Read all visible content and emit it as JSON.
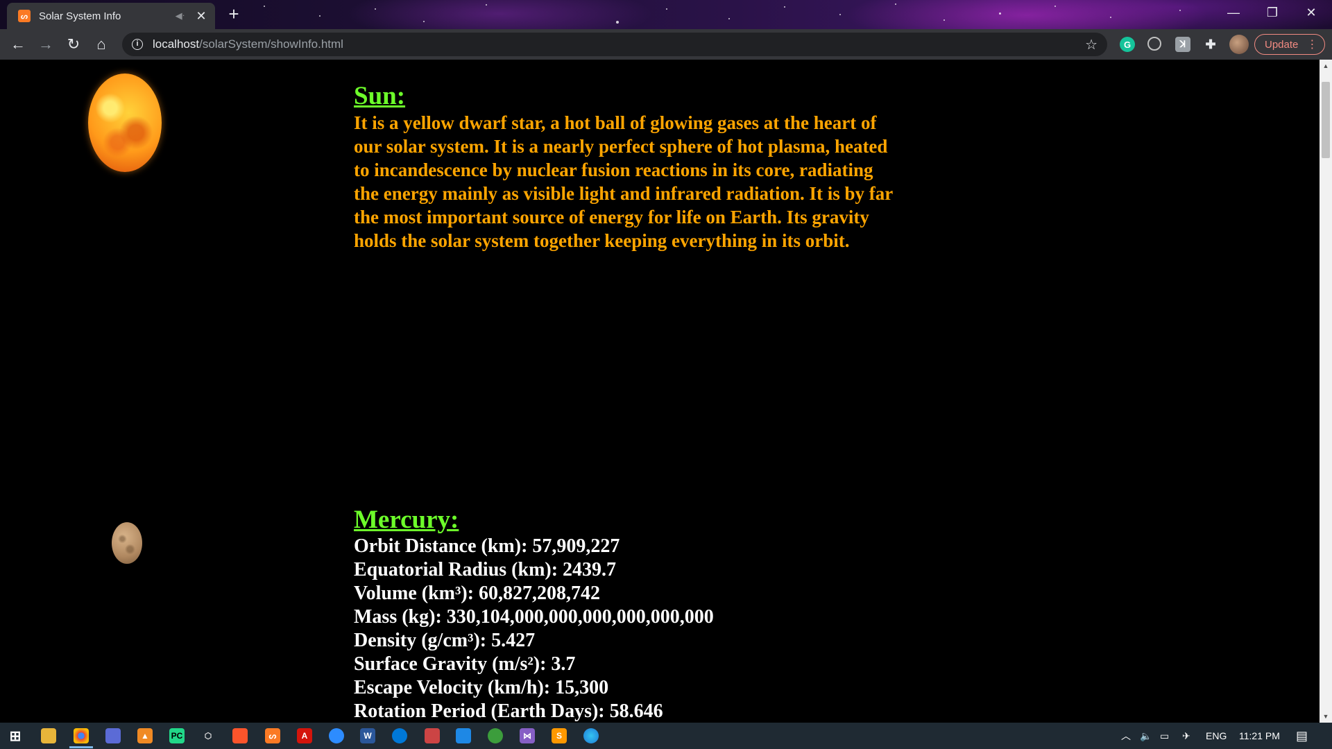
{
  "browser": {
    "tab_title": "Solar System Info",
    "url_host": "localhost",
    "url_path": "/solarSystem/showInfo.html",
    "update_label": "Update"
  },
  "page": {
    "sun": {
      "title": "Sun:",
      "description": "It is a yellow dwarf star, a hot ball of glowing gases at the heart of our solar system. It is a nearly perfect sphere of hot plasma, heated to incandescence by nuclear fusion reactions in its core, radiating the energy mainly as visible light and infrared radiation. It is by far the most important source of energy for life on Earth. Its gravity holds the solar system together keeping everything in its orbit."
    },
    "mercury": {
      "title": "Mercury:",
      "stats": [
        "Orbit Distance (km): 57,909,227",
        "Equatorial Radius (km): 2439.7",
        "Volume (km³): 60,827,208,742",
        "Mass (kg): 330,104,000,000,000,000,000,000",
        "Density (g/cm³): 5.427",
        "Surface Gravity (m/s²): 3.7",
        "Escape Velocity (km/h): 15,300",
        "Rotation Period (Earth Days): 58.646"
      ]
    }
  },
  "colors": {
    "heading": "#6dff2a",
    "sun_text": "#ffa500",
    "stat_text": "#ffffff",
    "page_bg": "#000000"
  },
  "taskbar": {
    "language": "ENG",
    "time": "11:21 PM"
  }
}
